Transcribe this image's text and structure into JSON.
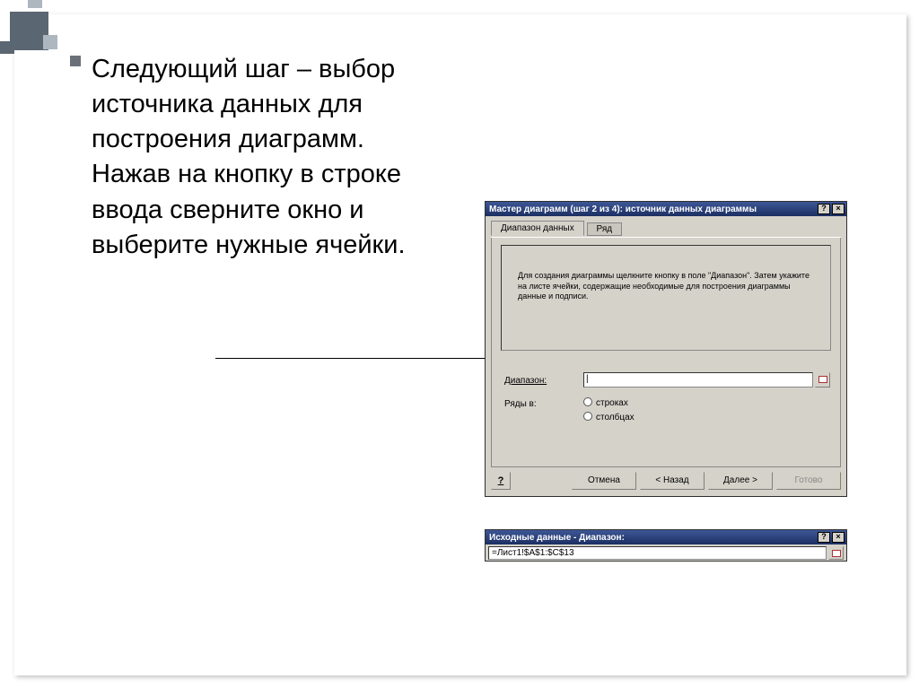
{
  "slide": {
    "bullet_text": "Следующий шаг – выбор источника данных для построения диаграмм. Нажав на кнопку в строке ввода сверните окно и выберите нужные ячейки."
  },
  "dialog1": {
    "title": "Мастер диаграмм (шаг 2 из 4): источник данных диаграммы",
    "help_icon": "?",
    "close_icon": "×",
    "tabs": {
      "data_range": "Диапазон данных",
      "series": "Ряд"
    },
    "hint": "Для создания диаграммы щелкните кнопку в поле \"Диапазон\". Затем укажите на листе ячейки, содержащие необходимые для построения диаграммы данные и подписи.",
    "range_label": "Диапазон:",
    "range_value": "|",
    "rows_label": "Ряды в:",
    "rows_opt1": "строках",
    "rows_opt2": "столбцах",
    "help_btn": "?",
    "btn_cancel": "Отмена",
    "btn_back": "< Назад",
    "btn_next": "Далее >",
    "btn_finish": "Готово"
  },
  "dialog2": {
    "title": "Исходные данные - Диапазон:",
    "help_icon": "?",
    "close_icon": "×",
    "value": "=Лист1!$A$1:$C$13"
  }
}
